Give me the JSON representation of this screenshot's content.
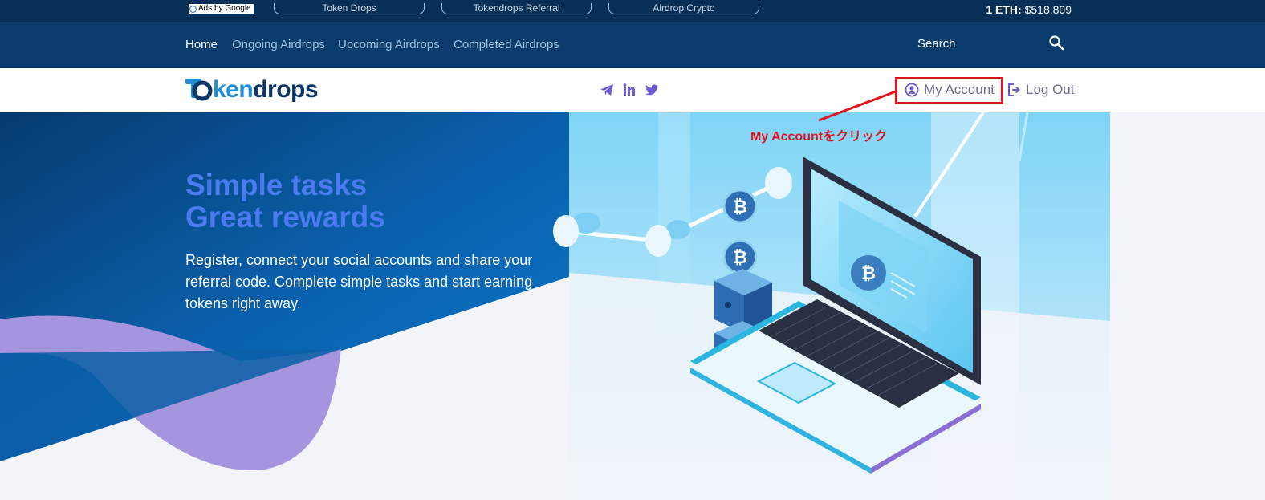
{
  "adbar": {
    "ads_by_label": "Ads by Google",
    "ad_links": [
      "Token Drops",
      "Tokendrops Referral",
      "Airdrop Crypto"
    ],
    "eth_label": "1 ETH:",
    "eth_price": "$518.809"
  },
  "nav": {
    "items": [
      "Home",
      "Ongoing Airdrops",
      "Upcoming Airdrops",
      "Completed Airdrops"
    ],
    "search_label": "Search"
  },
  "brand": {
    "logo_prefix": "ken",
    "logo_suffix": "drops",
    "social_icons": [
      "telegram-icon",
      "linkedin-icon",
      "twitter-icon"
    ],
    "my_account": "My Account",
    "log_out": "Log Out"
  },
  "hero": {
    "title_line1": "Simple tasks",
    "title_line2": "Great rewards",
    "description": "Register, connect your social accounts and share your referral code. Complete simple tasks and start earning tokens right away."
  },
  "annotation": {
    "text": "My Accountをクリック",
    "color": "#e0141e"
  },
  "colors": {
    "adbar": "#082f55",
    "navbar": "#0a3d6e",
    "hero_title": "#4a7bf0",
    "accent": "#6b5bd6"
  }
}
